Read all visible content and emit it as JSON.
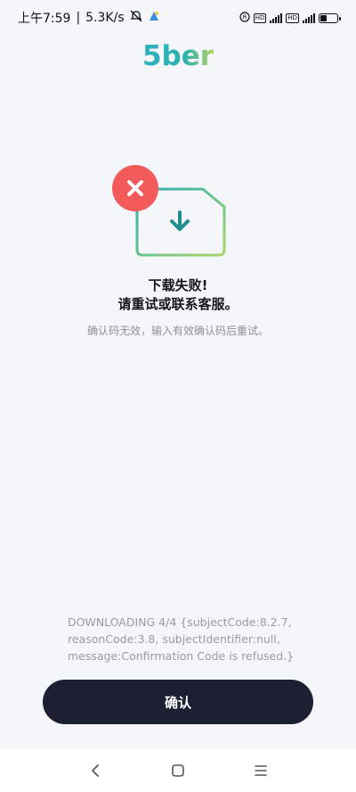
{
  "status_bar": {
    "time": "上午7:59",
    "network_speed": "5.3K/s",
    "battery_percent": 40
  },
  "app": {
    "logo_text": "5ber"
  },
  "colors": {
    "accent_gradient_start": "#2bb3b1",
    "accent_gradient_end": "#a5d36a",
    "error_red": "#f35a5a",
    "button_bg": "#1d1f33",
    "logo_teal": "#31b3b9"
  },
  "icons": {
    "illustration": "download-card-icon",
    "error": "close-icon",
    "download": "arrow-down-icon"
  },
  "message": {
    "title_line1": "下载失败!",
    "title_line2": "请重试或联系客服。",
    "subtitle": "确认码无效，输入有效确认码后重试。"
  },
  "error_detail": "DOWNLOADING 4/4 {subjectCode:8.2.7, reasonCode:3.8, subjectIdentifier:null, message:Confirmation Code is refused.}",
  "actions": {
    "confirm_label": "确认"
  },
  "nav": {
    "back": "back-icon",
    "home": "home-icon",
    "menu": "menu-icon"
  }
}
